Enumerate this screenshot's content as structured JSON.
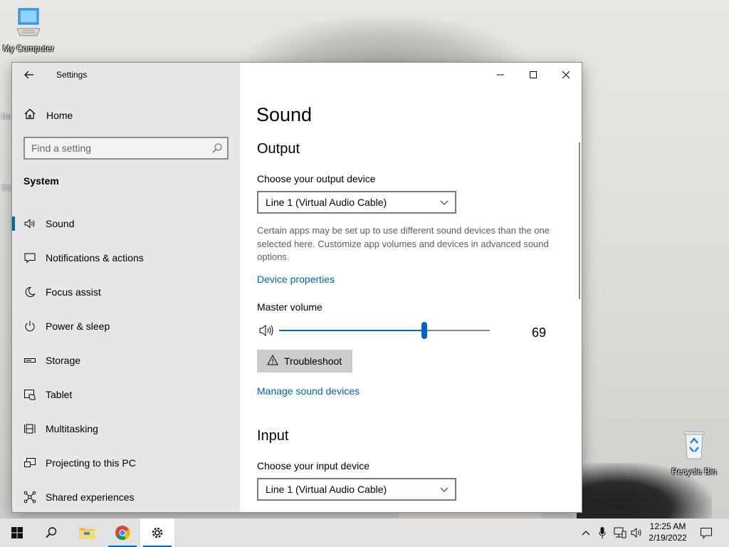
{
  "desktop": {
    "icons": [
      {
        "label": "My Computer",
        "icon": "computer-icon"
      },
      {
        "label": "Recycle Bin",
        "icon": "recycle-bin-icon"
      }
    ],
    "stray_labels": [
      "Da",
      "232"
    ]
  },
  "window": {
    "title": "Settings",
    "controls": {
      "minimize": "minimize-icon",
      "maximize": "maximize-icon",
      "close": "close-icon"
    }
  },
  "sidebar": {
    "home_label": "Home",
    "search_placeholder": "Find a setting",
    "section": "System",
    "items": [
      {
        "label": "Sound",
        "icon": "speaker-icon",
        "active": true
      },
      {
        "label": "Notifications & actions",
        "icon": "notification-icon"
      },
      {
        "label": "Focus assist",
        "icon": "moon-icon"
      },
      {
        "label": "Power & sleep",
        "icon": "power-icon"
      },
      {
        "label": "Storage",
        "icon": "storage-icon"
      },
      {
        "label": "Tablet",
        "icon": "tablet-icon"
      },
      {
        "label": "Multitasking",
        "icon": "multitasking-icon"
      },
      {
        "label": "Projecting to this PC",
        "icon": "projecting-icon"
      },
      {
        "label": "Shared experiences",
        "icon": "shared-experiences-icon"
      }
    ]
  },
  "main": {
    "title": "Sound",
    "output": {
      "heading": "Output",
      "device_label": "Choose your output device",
      "device_value": "Line 1 (Virtual Audio Cable)",
      "description": "Certain apps may be set up to use different sound devices than the one selected here. Customize app volumes and devices in advanced sound options.",
      "device_properties_link": "Device properties",
      "master_volume_label": "Master volume",
      "volume": 69,
      "volume_display": "69",
      "troubleshoot_label": "Troubleshoot",
      "manage_devices_link": "Manage sound devices"
    },
    "input": {
      "heading": "Input",
      "device_label": "Choose your input device",
      "device_value": "Line 1 (Virtual Audio Cable)"
    }
  },
  "taskbar": {
    "apps": [
      "start-icon",
      "search-icon",
      "file-explorer-icon",
      "chrome-icon",
      "settings-icon"
    ],
    "active_app": "settings-icon",
    "tray_icons": [
      "chevron-up-icon",
      "microphone-icon",
      "network-icon",
      "volume-icon"
    ],
    "time": "12:25 AM",
    "date": "2/19/2022"
  },
  "colors": {
    "accent": "#0067c0",
    "link": "#0064b4",
    "sidebar_bg": "#e6e6e6"
  }
}
